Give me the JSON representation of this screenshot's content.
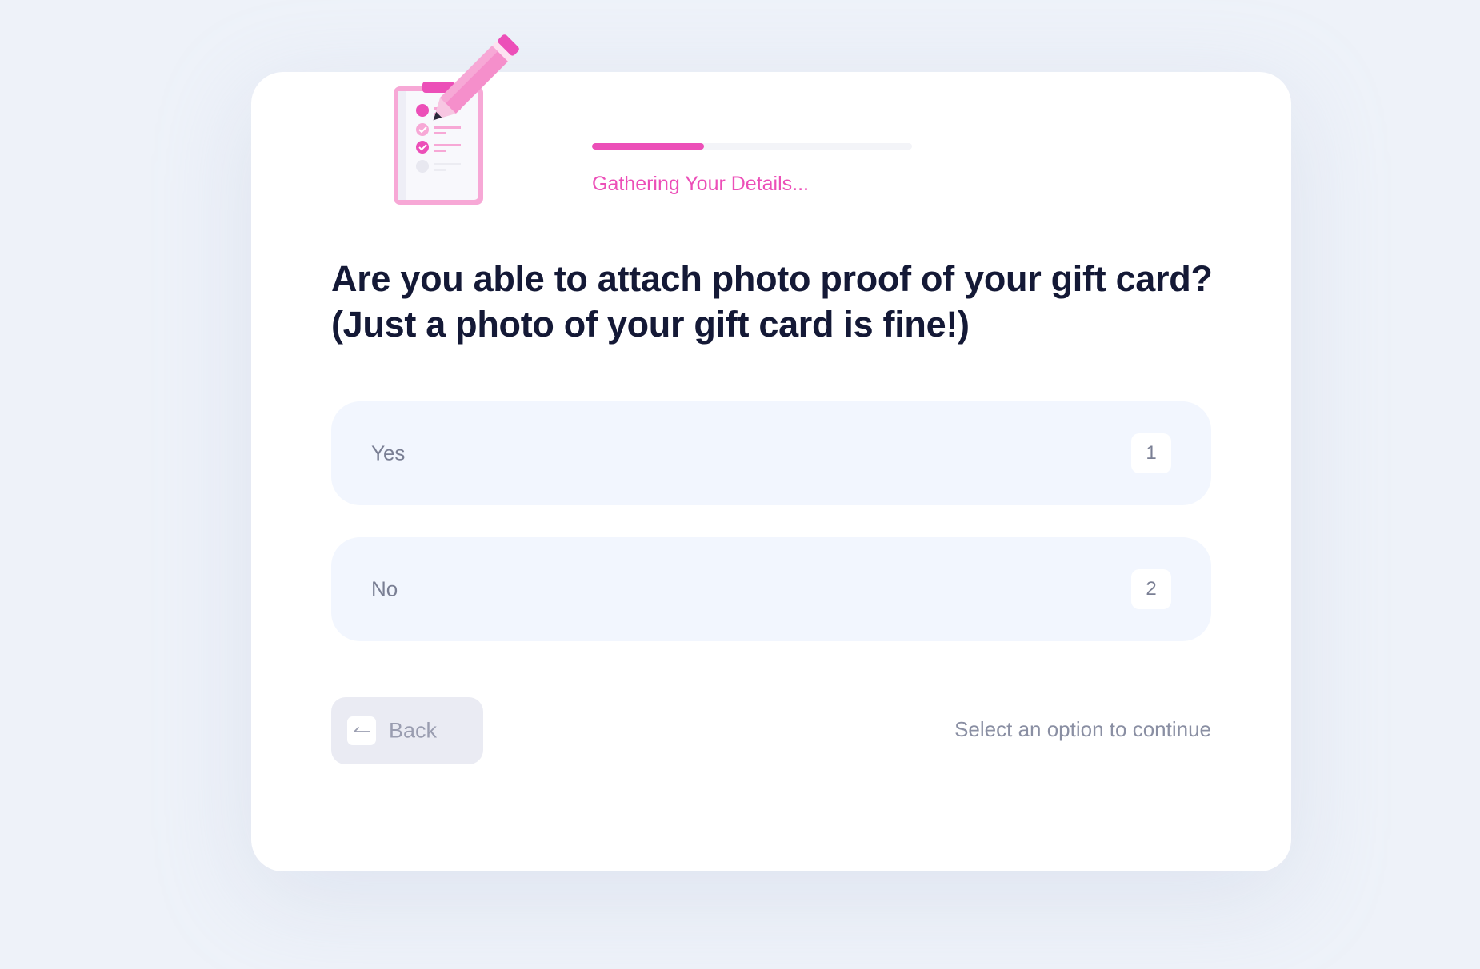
{
  "progress": {
    "label": "Gathering Your Details...",
    "fraction": 0.35
  },
  "question": {
    "line1": "Are you able to attach photo proof of your gift card?",
    "line2": "(Just a photo of your gift card is fine!)"
  },
  "options": [
    {
      "label": "Yes",
      "key": "1"
    },
    {
      "label": "No",
      "key": "2"
    }
  ],
  "footer": {
    "back_label": "Back",
    "hint": "Select an option to continue"
  },
  "colors": {
    "accent": "#ec4fb8",
    "heading": "#141936",
    "option_bg": "#f2f6fe"
  },
  "icons": {
    "illustration": "clipboard-checklist-pencil-icon",
    "back": "arrow-left-icon"
  }
}
